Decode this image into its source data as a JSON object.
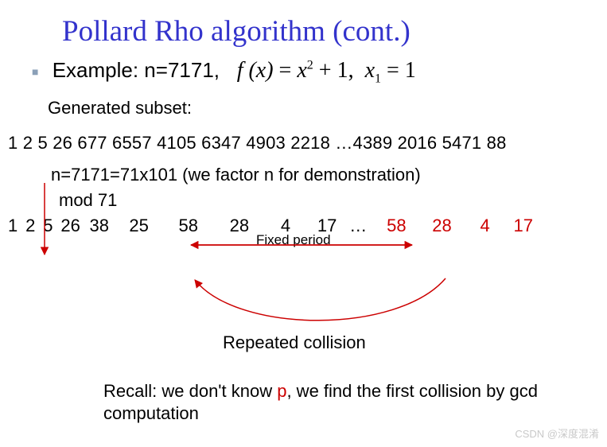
{
  "title": "Pollard Rho algorithm (cont.)",
  "bullet": {
    "example_label": "Example: n=7171,",
    "formula_f": "f (x)",
    "formula_eq1": " = ",
    "formula_x": "x",
    "formula_plus": " + 1,",
    "formula_x1": "x",
    "formula_eq2": " = 1"
  },
  "generated_subset_label": "Generated subset:",
  "seq1": "1 2 5 26 677 6557 4105 6347 4903 2218 …4389 2016 5471 88",
  "factor_note": "n=7171=71x101 (we factor n for demonstration)",
  "mod_label": "mod 71",
  "fixed_period_label": "Fixed period",
  "seq2": {
    "black": [
      "1",
      "2",
      "5",
      "26",
      "38",
      "25",
      "58",
      "28",
      "4",
      "17",
      "…"
    ],
    "red": [
      "58",
      "28",
      "4",
      "17"
    ]
  },
  "collision_label": "Repeated collision",
  "recall_text_a": "Recall: we don't know ",
  "recall_p": "p",
  "recall_text_b": ", we find the first collision by gcd computation",
  "watermark": "CSDN @深度混淆"
}
